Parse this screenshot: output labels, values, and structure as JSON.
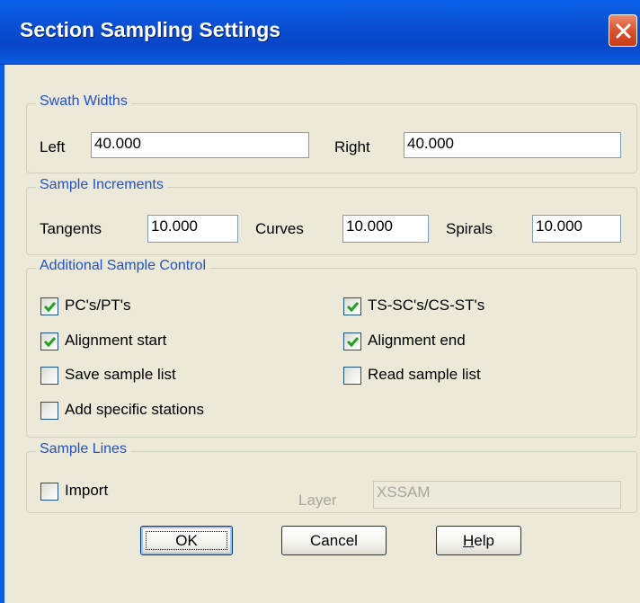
{
  "dialog": {
    "title": "Section Sampling Settings"
  },
  "swath_widths": {
    "group_label": "Swath Widths",
    "left_label": "Left",
    "left_value": "40.000",
    "right_label": "Right",
    "right_value": "40.000"
  },
  "sample_increments": {
    "group_label": "Sample Increments",
    "tangents_label": "Tangents",
    "tangents_value": "10.000",
    "curves_label": "Curves",
    "curves_value": "10.000",
    "spirals_label": "Spirals",
    "spirals_value": "10.000"
  },
  "additional_sample_control": {
    "group_label": "Additional Sample Control",
    "pcs_pts": {
      "label": "PC's/PT's",
      "checked": true
    },
    "ts_sc": {
      "label": "TS-SC's/CS-ST's",
      "checked": true
    },
    "alignment_start": {
      "label": "Alignment start",
      "checked": true
    },
    "alignment_end": {
      "label": "Alignment end",
      "checked": true
    },
    "save_sample_list": {
      "label": "Save sample list",
      "checked": false
    },
    "read_sample_list": {
      "label": "Read sample list",
      "checked": false
    },
    "add_specific_stations": {
      "label": "Add specific stations",
      "checked": false
    }
  },
  "sample_lines": {
    "group_label": "Sample Lines",
    "import": {
      "label": "Import",
      "checked": false
    },
    "layer_label": "Layer",
    "layer_value": "XSSAM"
  },
  "buttons": {
    "ok_label": "OK",
    "cancel_label": "Cancel",
    "help_prefix": "H",
    "help_rest": "elp"
  },
  "colors": {
    "title_bar": "#0a4fd3",
    "group_label": "#2151c6",
    "dialog_face": "#ece9d8",
    "check_mark": "#21a121"
  }
}
